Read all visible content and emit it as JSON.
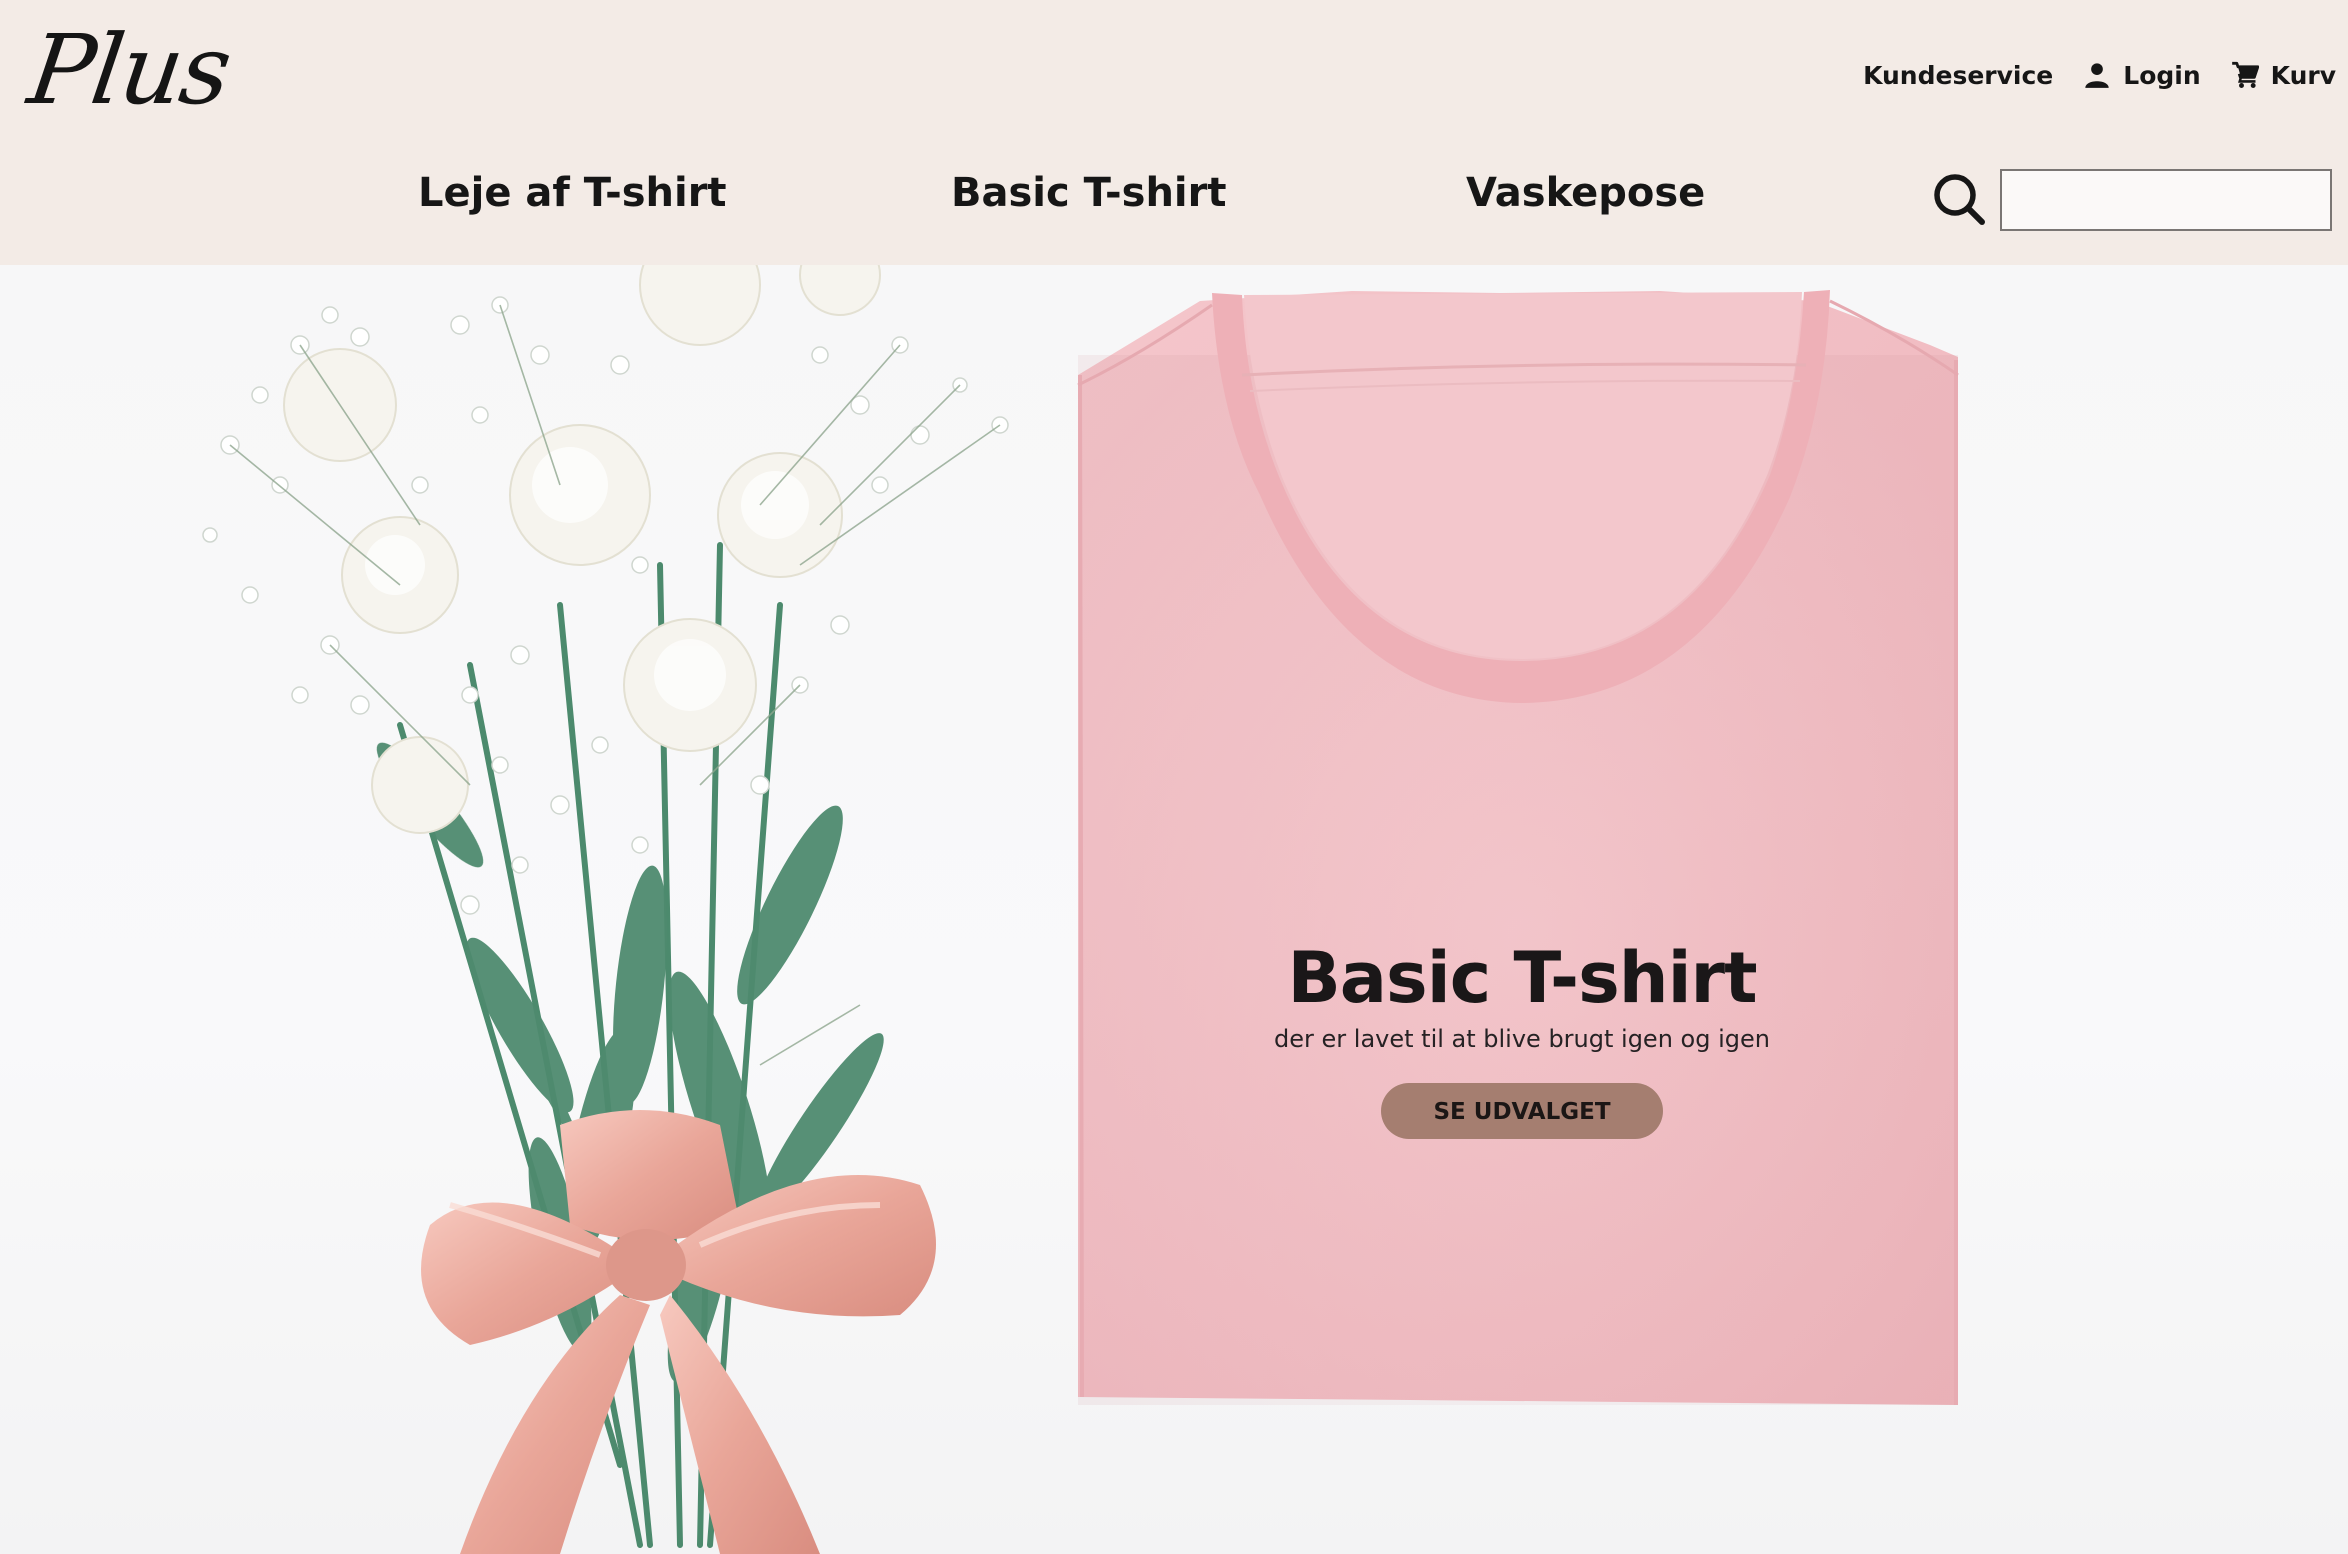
{
  "brand": {
    "logo_text": "Plus"
  },
  "utility_nav": {
    "customer_service": "Kundeservice",
    "login": "Login",
    "cart": "Kurv"
  },
  "main_nav": {
    "items": [
      {
        "label": "Leje af T-shirt"
      },
      {
        "label": "Basic T-shirt"
      },
      {
        "label": "Vaskepose"
      }
    ]
  },
  "search": {
    "value": "",
    "icon": "search-icon"
  },
  "hero": {
    "title": "Basic T-shirt",
    "subtitle": "der er lavet til at blive brugt igen og igen",
    "cta_label": "SE UDVALGET"
  },
  "colors": {
    "header_bg": "#f3ebe6",
    "cta_bg": "#a57e70",
    "tshirt_pink": "#f2c1c6",
    "ribbon": "#e8a79c"
  }
}
